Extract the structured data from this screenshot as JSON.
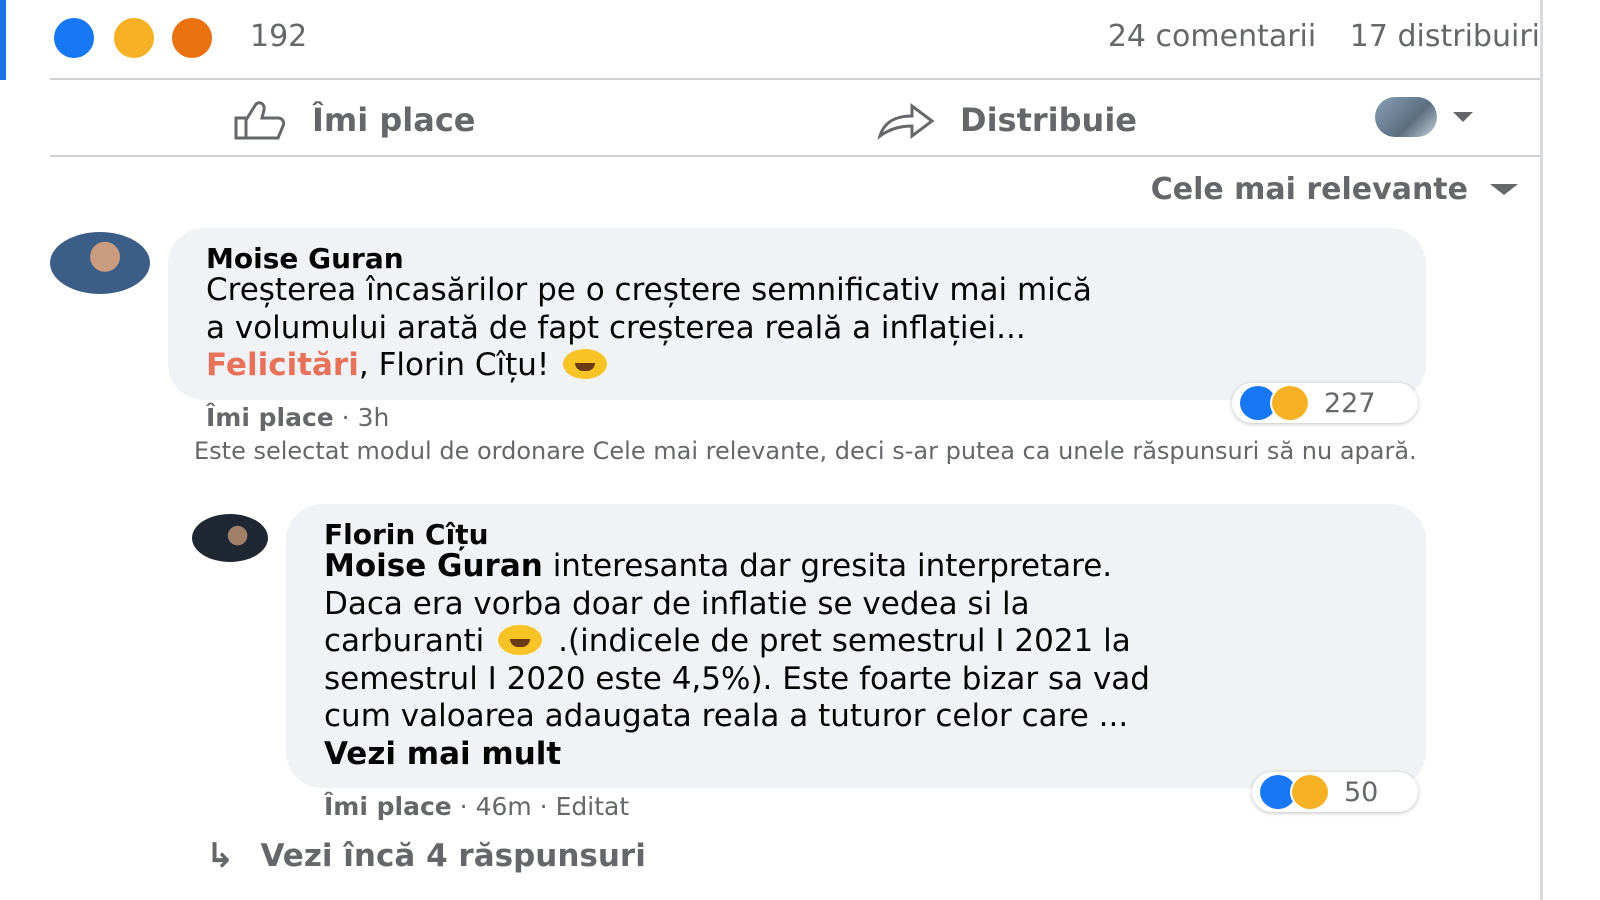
{
  "summary": {
    "reaction_count": "192",
    "comments_label": "24 comentarii",
    "shares_label": "17 distribuiri",
    "reactions": [
      "like",
      "haha",
      "angry"
    ]
  },
  "actions": {
    "like_label": "Îmi place",
    "share_label": "Distribuie"
  },
  "sort": {
    "label": "Cele mai relevante"
  },
  "comments": [
    {
      "author": "Moise Guran",
      "text_line1": "Creșterea încasărilor pe o creștere semnificativ mai mică",
      "text_line2": "a volumului arată de fapt creșterea reală a inflației...",
      "highlight": "Felicitări",
      "text_tail": ", Florin Cîțu!",
      "like_action": "Îmi place",
      "time": " · 3h",
      "reaction_count": "227"
    },
    {
      "author": "Florin Cîțu",
      "mention": "Moise Guran",
      "text_l1": " interesanta dar gresita interpretare.",
      "text_l2": "Daca era vorba doar de inflatie se vedea si la",
      "text_l3a": "carburanti",
      "text_l3b": " .(indicele de pret semestrul I 2021 la",
      "text_l4": "semestrul I 2020 este 4,5%). Este foarte bizar sa vad",
      "text_l5": "cum valoarea adaugata reala a tuturor celor care ...",
      "see_more": "Vezi mai mult",
      "like_action": "Îmi place",
      "time": " · 46m · Editat",
      "reaction_count": "50"
    }
  ],
  "note": "Este selectat modul de ordonare Cele mai relevante, deci s-ar putea ca unele răspunsuri să nu apară.",
  "more_replies": "Vezi încă 4 răspunsuri",
  "colors": {
    "accent": "#1877f2",
    "highlight": "#e8715a",
    "muted": "#65676b",
    "bubble": "#f0f2f5"
  }
}
